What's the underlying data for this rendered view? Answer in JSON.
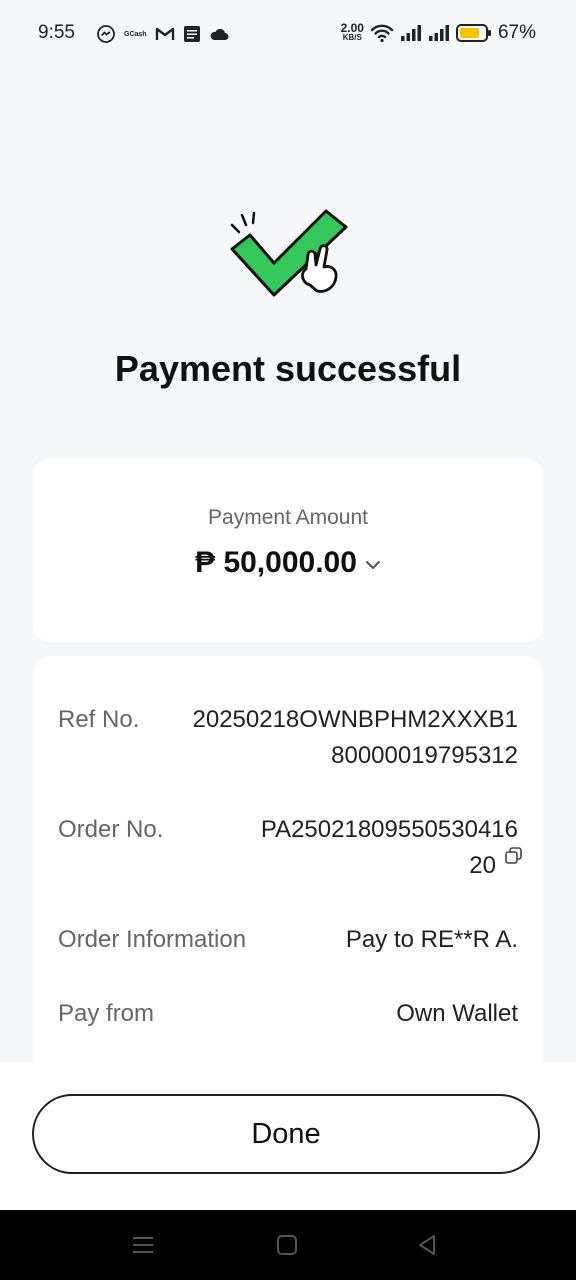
{
  "status_bar": {
    "time": "9:55",
    "left_icons": [
      "messenger-icon",
      "gcash-icon",
      "gmail-icon",
      "gotyme-bank-icon",
      "cloud-icon"
    ],
    "gcash_text": "GCash",
    "net_speed_value": "2.00",
    "net_speed_unit": "KB/S",
    "battery_percent": "67%"
  },
  "page": {
    "title": "Payment successful"
  },
  "amount": {
    "label": "Payment Amount",
    "value": "₱ 50,000.00"
  },
  "details": [
    {
      "label": "Ref No.",
      "value_line1": "20250218OWNBPHM2XXXB1",
      "value_line2": "80000019795312"
    },
    {
      "label": "Order No.",
      "value_line1": "PA25021809550530416",
      "value_line2": "20"
    },
    {
      "label": "Order Information",
      "value_line1": "Pay to RE**R A."
    },
    {
      "label": "Pay from",
      "value_line1": "Own Wallet"
    }
  ],
  "done_label": "Done",
  "colors": {
    "check_green": "#34c759",
    "battery_yellow": "#f5c400",
    "background": "#f6f7f8"
  }
}
